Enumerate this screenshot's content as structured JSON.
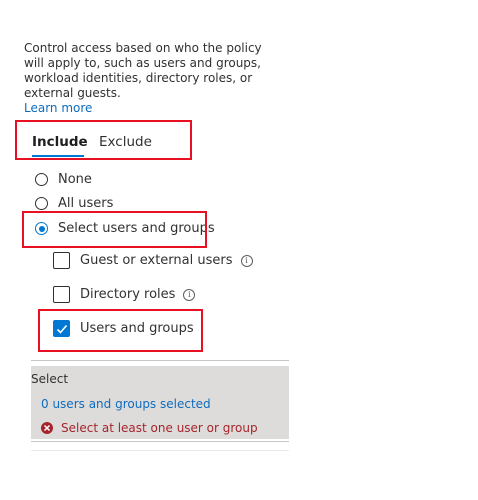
{
  "description": {
    "text": "Control access based on who the policy will apply to, such as users and groups, workload identities, directory roles, or external guests.",
    "learn_more": "Learn more"
  },
  "tabs": [
    {
      "label": "Include",
      "selected": true
    },
    {
      "label": "Exclude",
      "selected": false
    }
  ],
  "radios": [
    {
      "label": "None",
      "checked": false
    },
    {
      "label": "All users",
      "checked": false
    },
    {
      "label": "Select users and groups",
      "checked": true
    }
  ],
  "checkboxes": [
    {
      "label": "Guest or external users",
      "checked": false,
      "has_info": true
    },
    {
      "label": "Directory roles",
      "checked": false,
      "has_info": true
    },
    {
      "label": "Users and groups",
      "checked": true,
      "has_info": false
    }
  ],
  "select_panel": {
    "title": "Select",
    "link": "0 users and groups selected",
    "error": "Select at least one user or group"
  },
  "colors": {
    "accent": "#0078d4",
    "highlight_box": "#e81123",
    "error": "#a4262c",
    "panel_bg": "#dedcdb"
  }
}
